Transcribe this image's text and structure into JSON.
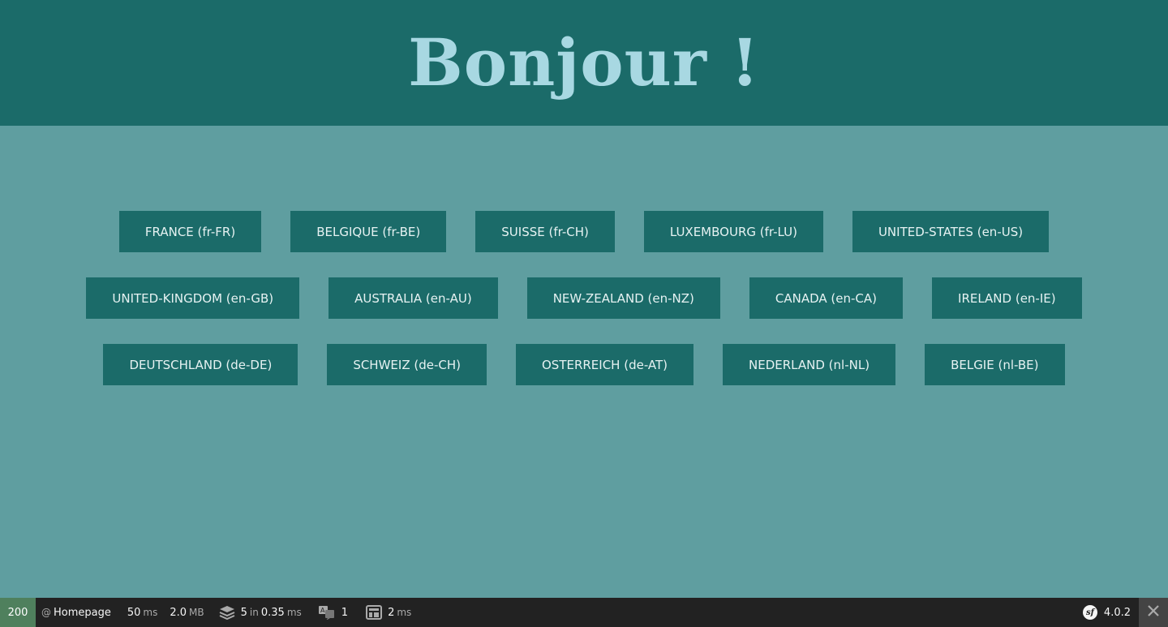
{
  "header": {
    "title": "Bonjour !"
  },
  "languages": {
    "row1": [
      "FRANCE (fr-FR)",
      "BELGIQUE (fr-BE)",
      "SUISSE (fr-CH)",
      "LUXEMBOURG (fr-LU)",
      "UNITED-STATES (en-US)"
    ],
    "row2": [
      "UNITED-KINGDOM (en-GB)",
      "AUSTRALIA (en-AU)",
      "NEW-ZEALAND (en-NZ)",
      "CANADA (en-CA)",
      "IRELAND (en-IE)"
    ],
    "row3": [
      "DEUTSCHLAND (de-DE)",
      "SCHWEIZ (de-CH)",
      "OSTERREICH (de-AT)",
      "NEDERLAND (nl-NL)",
      "BELGIE (nl-BE)"
    ]
  },
  "toolbar": {
    "status_code": "200",
    "at_symbol": "@",
    "route": "Homepage",
    "time_value": "50",
    "time_unit": "ms",
    "memory_value": "2.0",
    "memory_unit": "MB",
    "queries_count": "5",
    "queries_in": "in",
    "queries_time": "0.35",
    "queries_unit": "ms",
    "translations_count": "1",
    "twig_value": "2",
    "twig_unit": "ms",
    "symfony_version": "4.0.2",
    "symfony_logo_text": "sf"
  },
  "colors": {
    "background": "#5f9ea0",
    "header_bg": "#1b6b69",
    "title_color": "#a8d8e2",
    "button_bg": "#1b6b69",
    "button_text": "#e6f2f2",
    "toolbar_bg": "#222222",
    "status_ok": "#4f805d"
  },
  "icons": {
    "db": "database-icon",
    "translation": "translation-icon",
    "twig": "template-icon",
    "symfony": "symfony-logo-icon",
    "close": "close-icon"
  }
}
